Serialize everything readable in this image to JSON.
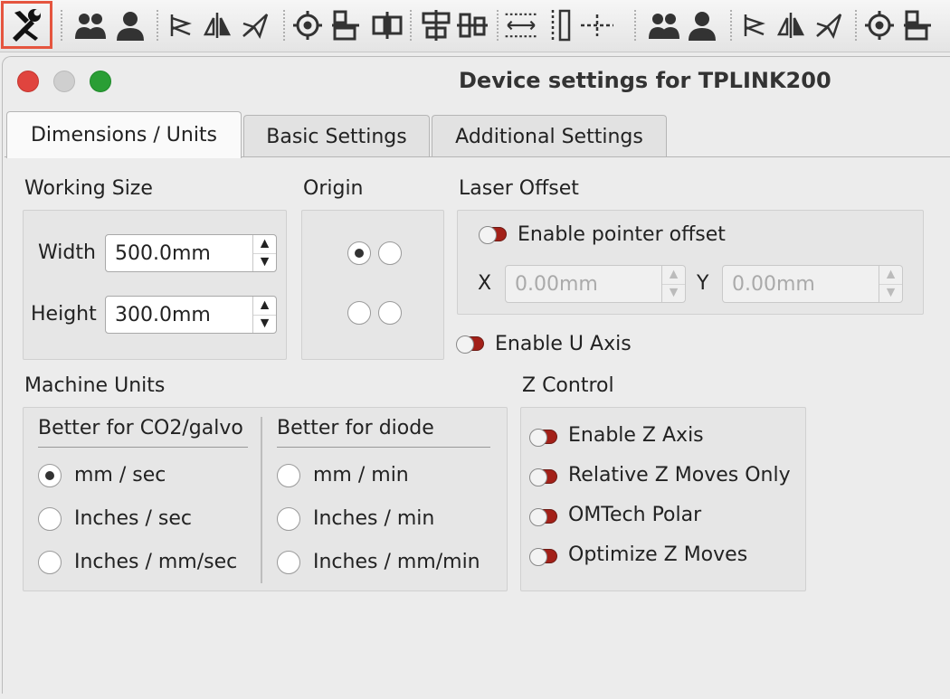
{
  "window": {
    "title": "Device settings for TPLINK200"
  },
  "tabs": [
    {
      "label": "Dimensions / Units",
      "active": true
    },
    {
      "label": "Basic Settings",
      "active": false
    },
    {
      "label": "Additional Settings",
      "active": false
    }
  ],
  "working_size": {
    "title": "Working Size",
    "width_label": "Width",
    "width_value": "500.0mm",
    "height_label": "Height",
    "height_value": "300.0mm"
  },
  "origin": {
    "title": "Origin",
    "selected": "top-left"
  },
  "laser_offset": {
    "title": "Laser Offset",
    "enable_label": "Enable pointer offset",
    "x_label": "X",
    "x_value": "0.00mm",
    "y_label": "Y",
    "y_value": "0.00mm"
  },
  "u_axis": {
    "enable_label": "Enable U Axis"
  },
  "machine_units": {
    "title": "Machine Units",
    "co2_header": "Better for CO2/galvo",
    "diode_header": "Better for diode",
    "co2_options": [
      "mm / sec",
      "Inches / sec",
      "Inches / mm/sec"
    ],
    "diode_options": [
      "mm / min",
      "Inches / min",
      "Inches / mm/min"
    ],
    "selected": "mm / sec"
  },
  "z_control": {
    "title": "Z Control",
    "options": [
      "Enable Z Axis",
      "Relative Z Moves Only",
      "OMTech Polar",
      "Optimize Z Moves"
    ]
  },
  "colors": {
    "close": "#e0443e",
    "minimize": "#cfcfcf",
    "maximize": "#2a9e35",
    "toggle_red": "#a32018",
    "highlight": "#e5553f"
  },
  "toolbar_icons": [
    "wrench-icon",
    "users-group-icon",
    "user-icon",
    "align-left-icon",
    "mirror-icon",
    "send-icon",
    "target-icon",
    "align-top-icon",
    "align-center-icon",
    "distribute-h-icon",
    "distribute-v-icon",
    "space-h-icon",
    "space-v-icon",
    "users-group-icon",
    "user-icon",
    "align-left-icon",
    "mirror-icon",
    "send-icon",
    "target-icon",
    "align-top-icon"
  ]
}
